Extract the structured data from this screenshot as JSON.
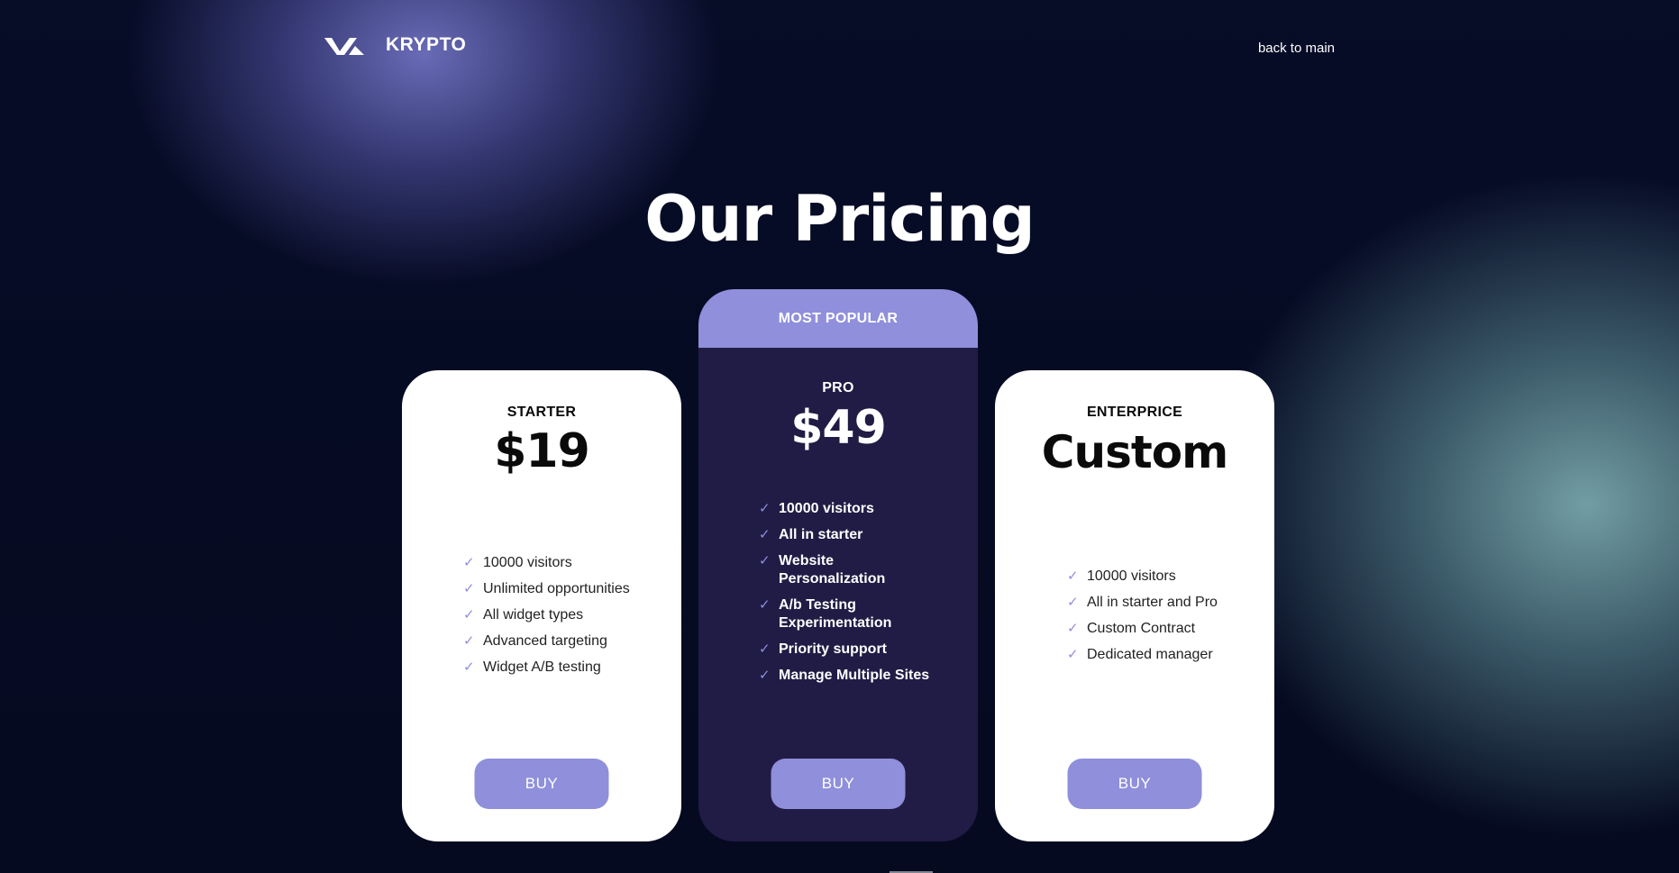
{
  "header": {
    "brand": "KRYPTO",
    "logo_icon": "va-logo-icon",
    "back_link": "back to main"
  },
  "title": "Our Pricing",
  "colors": {
    "accent": "#8f8fdb",
    "pro_card_bg": "#201c45",
    "page_bg": "#050a22"
  },
  "plans": [
    {
      "name": "STARTER",
      "price": "$19",
      "features": [
        "10000 visitors",
        "Unlimited opportunities",
        "All widget types",
        "Advanced targeting",
        "Widget A/B testing"
      ],
      "button": "BUY"
    },
    {
      "badge": "MOST POPULAR",
      "name": "PRO",
      "price": "$49",
      "features": [
        "10000 visitors",
        "All in starter",
        "Website Personalization",
        "A/b Testing Experimentation",
        "Priority support",
        "Manage Multiple Sites"
      ],
      "button": "BUY"
    },
    {
      "name": "ENTERPRICE",
      "price": "Custom",
      "features": [
        "10000 visitors",
        "All in starter and Pro",
        "Custom Contract",
        "Dedicated manager"
      ],
      "button": "BUY"
    }
  ],
  "check_icon": "check-icon"
}
